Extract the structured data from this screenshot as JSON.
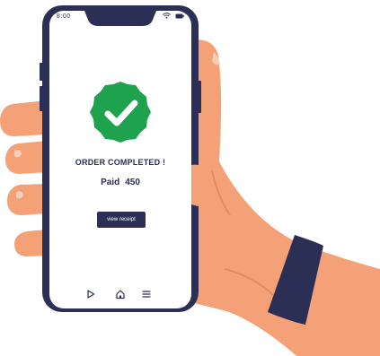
{
  "status": {
    "time": "8:00"
  },
  "order": {
    "title": "ORDER COMPLETED !",
    "paid_label": "Paid",
    "paid_amount": "450",
    "receipt_label": "view receipt"
  },
  "icons": {
    "status": [
      "wifi-icon",
      "battery-icon"
    ],
    "nav": [
      "play-icon",
      "home-icon",
      "menu-icon"
    ],
    "badge": "check-badge-icon"
  },
  "colors": {
    "navy": "#2b2f55",
    "badge_green": "#1ea24e",
    "skin": "#f4a178",
    "skin_shadow": "#e38a63",
    "wristband": "#2b2f55"
  }
}
